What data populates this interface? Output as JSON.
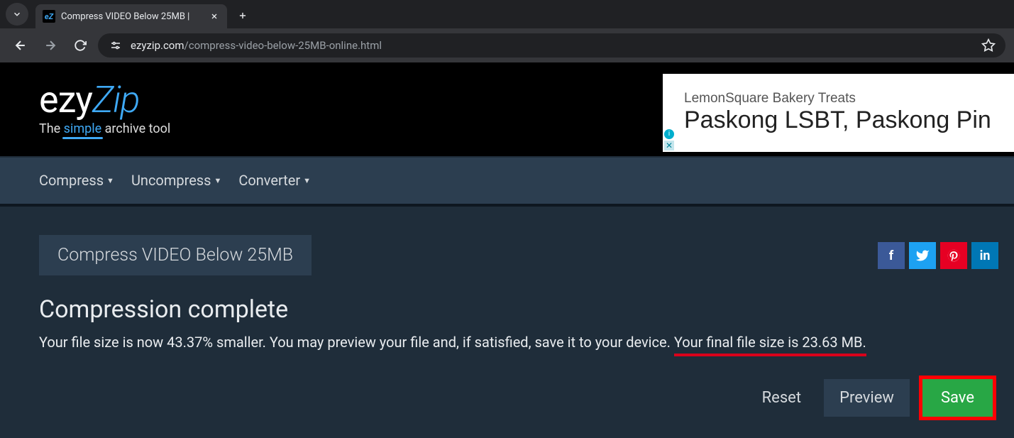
{
  "browser": {
    "tab_favicon": "eZ",
    "tab_title": "Compress VIDEO Below 25MB | ",
    "url_domain": "ezyzip.com",
    "url_path": "/compress-video-below-25MB-online.html"
  },
  "logo": {
    "part1": "ezy",
    "part2": "Zip",
    "tagline_pre": "The ",
    "tagline_highlight": "simple",
    "tagline_post": " archive tool"
  },
  "ad": {
    "line1": "LemonSquare Bakery Treats",
    "line2": "Paskong LSBT, Paskong Pin"
  },
  "nav": {
    "compress": "Compress",
    "uncompress": "Uncompress",
    "converter": "Converter"
  },
  "main": {
    "tab_label": "Compress VIDEO Below 25MB",
    "complete_title": "Compression complete",
    "text_pre": "Your file size is now 43.37% smaller. You may preview your file and, if satisfied, save it to your device. ",
    "text_highlight": "Your final file size is 23.63 MB.",
    "reset_label": "Reset",
    "preview_label": "Preview",
    "save_label": "Save"
  },
  "share": {
    "facebook": "f",
    "pinterest": "P",
    "linkedin": "in"
  }
}
